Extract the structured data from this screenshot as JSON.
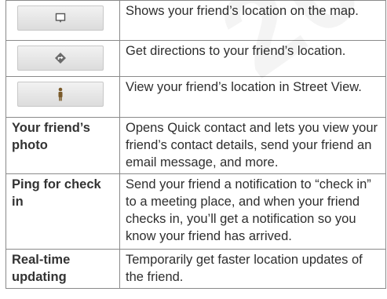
{
  "rows": [
    {
      "icon": "map-pin-icon",
      "description": "Shows your friend’s location on the map."
    },
    {
      "icon": "directions-icon",
      "description": "Get directions to your friend’s location."
    },
    {
      "icon": "street-view-person-icon",
      "description": "View your friend’s location in Street View."
    },
    {
      "label": "Your friend’s photo",
      "description": "Opens Quick contact and lets you view your friend’s contact details, send your friend an email message, and more."
    },
    {
      "label": "Ping for check in",
      "description": "Send your friend a notification to “check in” to a meeting place, and when your friend checks in, you’ll get a notification so you know your friend has arrived."
    },
    {
      "label": "Real-time updating",
      "description": "Temporarily get faster location updates of the friend."
    }
  ],
  "watermark": "2011/0"
}
